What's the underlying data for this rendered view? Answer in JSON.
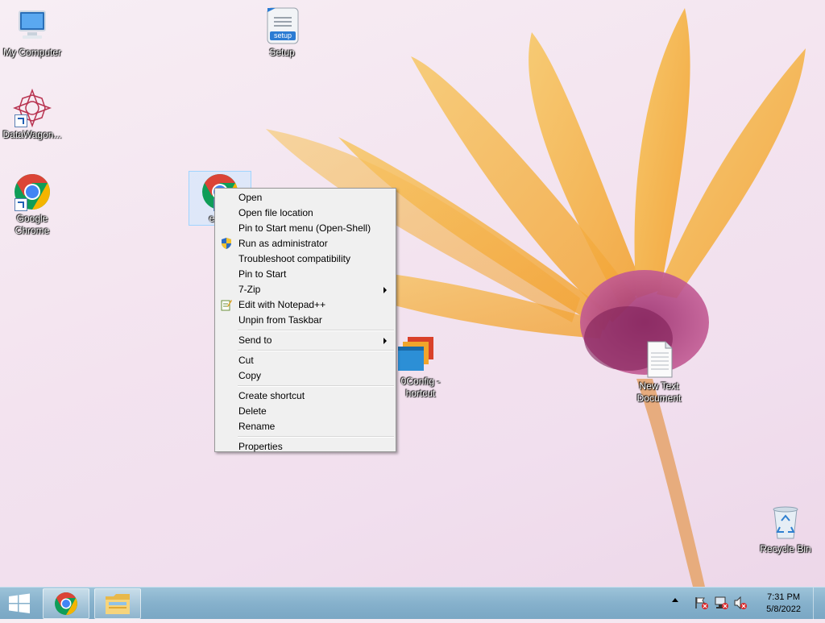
{
  "desktop": {
    "icons": {
      "my_computer": "My Computer",
      "setup": "Setup",
      "datawagon": "DataWagon...",
      "google_chrome": "Google Chrome",
      "selected_partial": "e",
      "config_shortcut": "0Config - hortcut",
      "new_text_document": "New Text Document",
      "recycle_bin": "Recycle Bin",
      "setup_badge": "setup"
    }
  },
  "context_menu": {
    "items": [
      {
        "label": "Open"
      },
      {
        "label": "Open file location"
      },
      {
        "label": "Pin to Start menu (Open-Shell)"
      },
      {
        "label": "Run as administrator"
      },
      {
        "label": "Troubleshoot compatibility"
      },
      {
        "label": "Pin to Start"
      },
      {
        "label": "7-Zip"
      },
      {
        "label": "Edit with Notepad++"
      },
      {
        "label": "Unpin from Taskbar"
      },
      {
        "label": "Send to"
      },
      {
        "label": "Cut"
      },
      {
        "label": "Copy"
      },
      {
        "label": "Create shortcut"
      },
      {
        "label": "Delete"
      },
      {
        "label": "Rename"
      },
      {
        "label": "Properties"
      }
    ]
  },
  "taskbar": {
    "time": "7:31 PM",
    "date": "5/8/2022"
  },
  "colors": {
    "menu_background": "#f0f0f0",
    "taskbar": "#86b1cc",
    "chrome_red": "#db4437",
    "chrome_yellow": "#f4b400",
    "chrome_green": "#0f9d58",
    "chrome_blue": "#4285f4"
  }
}
